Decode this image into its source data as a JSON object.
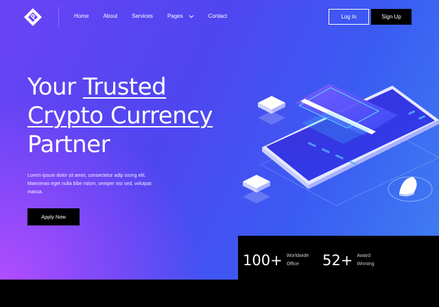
{
  "header": {
    "nav": [
      {
        "label": "Home"
      },
      {
        "label": "About"
      },
      {
        "label": "Services"
      },
      {
        "label": "Pages"
      },
      {
        "label": "Contact"
      }
    ],
    "login_label": "Log In",
    "signup_label": "Sign Up"
  },
  "hero": {
    "headline_part1": "Your ",
    "headline_part2": "Trusted",
    "headline_part3": "Crypto Currency",
    "headline_part4": "Partner",
    "description": "Lorem ipsum dolor sit amet, consectetur adip iscing elit. Maecenas eget nulla bibe ndum, semper nisi sed, volutpat massa.",
    "cta_label": "Apply Now"
  },
  "stats": [
    {
      "number": "100+",
      "label": "Worldwide Office"
    },
    {
      "number": "52+",
      "label": "Award Winning"
    }
  ],
  "icons": {
    "logo": "diamond-logo-icon",
    "pages_dropdown": "chevron-down-icon"
  },
  "colors": {
    "gradient_start": "#6a43f5",
    "gradient_end": "#3f7ff2",
    "glow": "#b04dff",
    "button_dark": "#000000"
  }
}
